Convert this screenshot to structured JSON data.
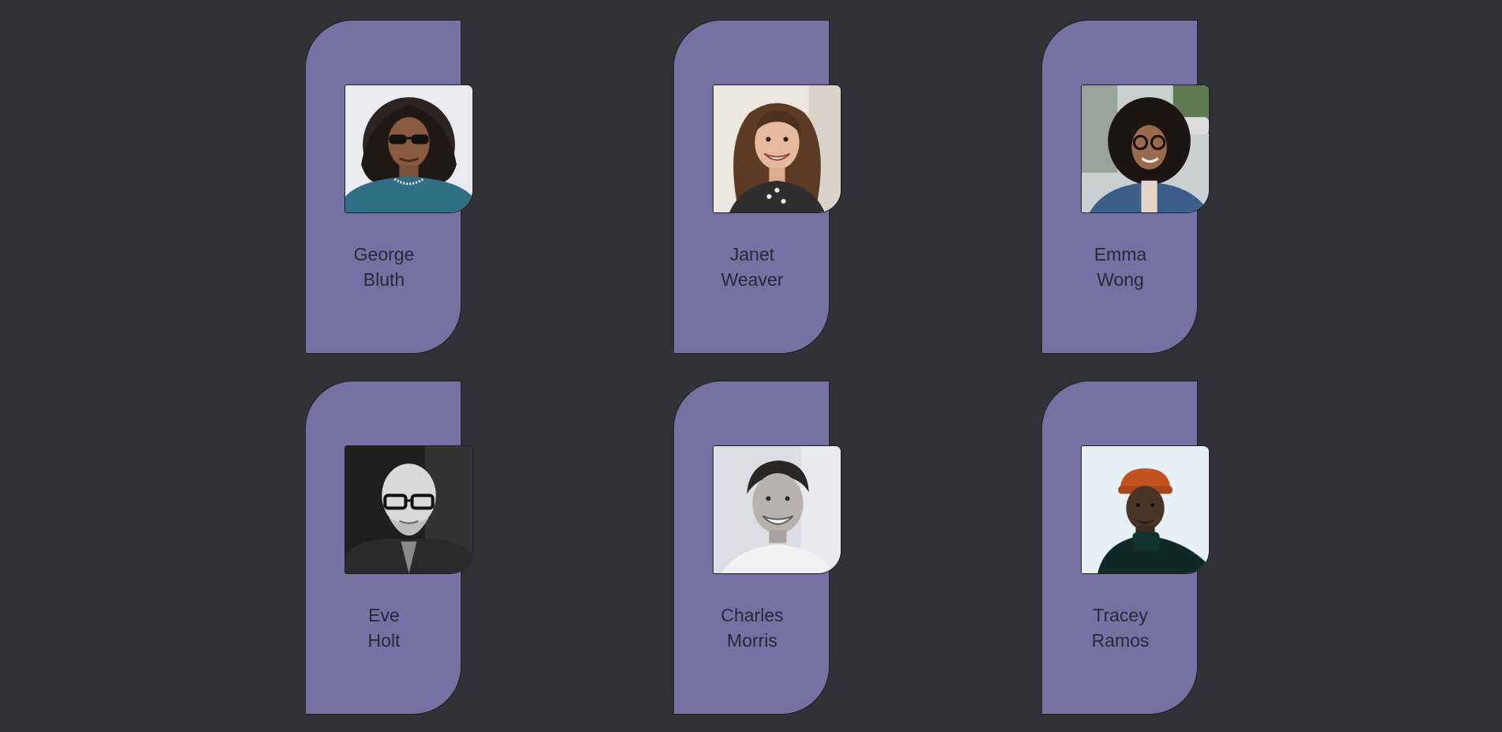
{
  "people": [
    {
      "first": "George",
      "last": "Bluth",
      "photo_icon": "person-with-sunglasses-long-curly-hair"
    },
    {
      "first": "Janet",
      "last": "Weaver",
      "photo_icon": "smiling-woman-curly-hair"
    },
    {
      "first": "Emma",
      "last": "Wong",
      "photo_icon": "woman-curly-hair-sunglasses-street"
    },
    {
      "first": "Eve",
      "last": "Holt",
      "photo_icon": "bald-man-glasses-grayscale"
    },
    {
      "first": "Charles",
      "last": "Morris",
      "photo_icon": "smiling-man-grayscale"
    },
    {
      "first": "Tracey",
      "last": "Ramos",
      "photo_icon": "man-orange-beanie"
    }
  ],
  "colors": {
    "background": "#323136",
    "card": "#7572a3",
    "border": "#1f1e24",
    "name_text": "#2a2933"
  }
}
